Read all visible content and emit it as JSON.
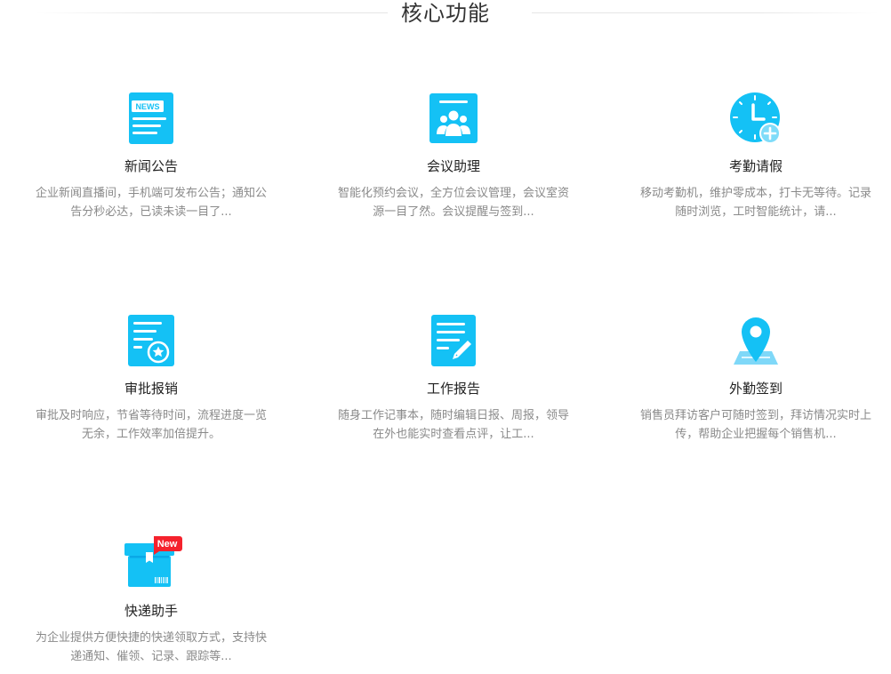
{
  "section": {
    "title": "核心功能"
  },
  "features": [
    {
      "name": "新闻公告",
      "desc": "企业新闻直播间，手机端可发布公告；通知公告分秒必达，已读未读一目了...",
      "icon": "news-icon",
      "icon_text": "NEWS"
    },
    {
      "name": "会议助理",
      "desc": "智能化预约会议，全方位会议管理，会议室资源一目了然。会议提醒与签到...",
      "icon": "meeting-icon"
    },
    {
      "name": "考勤请假",
      "desc": "移动考勤机，维护零成本，打卡无等待。记录随时浏览，工时智能统计，请...",
      "icon": "clock-icon"
    },
    {
      "name": "审批报销",
      "desc": "审批及时响应，节省等待时间，流程进度一览无余，工作效率加倍提升。",
      "icon": "approval-icon"
    },
    {
      "name": "工作报告",
      "desc": "随身工作记事本，随时编辑日报、周报，领导在外也能实时查看点评，让工...",
      "icon": "report-icon"
    },
    {
      "name": "外勤签到",
      "desc": "销售员拜访客户可随时签到，拜访情况实时上传，帮助企业把握每个销售机...",
      "icon": "location-pin-icon"
    },
    {
      "name": "快递助手",
      "desc": "为企业提供方便快捷的快递领取方式，支持快递通知、催领、记录、跟踪等...",
      "icon": "package-icon",
      "badge": "New"
    }
  ],
  "colors": {
    "primary": "#14c1f5",
    "primary_dark": "#0aa8e6",
    "badge": "#f5222d"
  }
}
